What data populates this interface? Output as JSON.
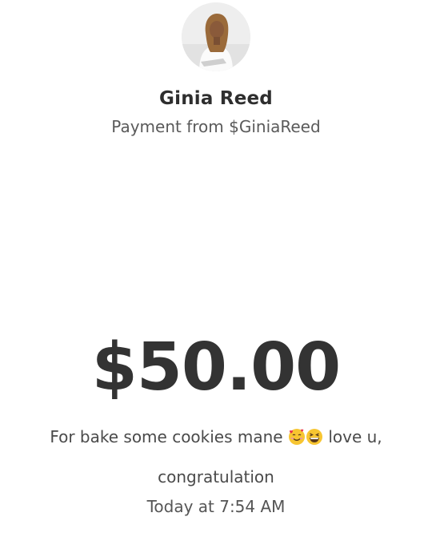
{
  "sender": {
    "name": "Ginia Reed",
    "subtitle": "Payment from $GiniaReed"
  },
  "payment": {
    "amount": "$50.00",
    "note_before": "For bake some cookies mane",
    "note_after": "love u,",
    "note_line2": "congratulation",
    "timestamp": "Today at 7:54 AM"
  },
  "icons": {
    "avatar": "profile-photo",
    "emoji_1": "smiling-face-with-hearts",
    "emoji_2": "grinning-squinting-face"
  },
  "colors": {
    "text_primary": "#2e2e2e",
    "text_secondary": "#5a5a5a",
    "emoji_yellow": "#f7c531",
    "heart_red": "#e8334a"
  }
}
